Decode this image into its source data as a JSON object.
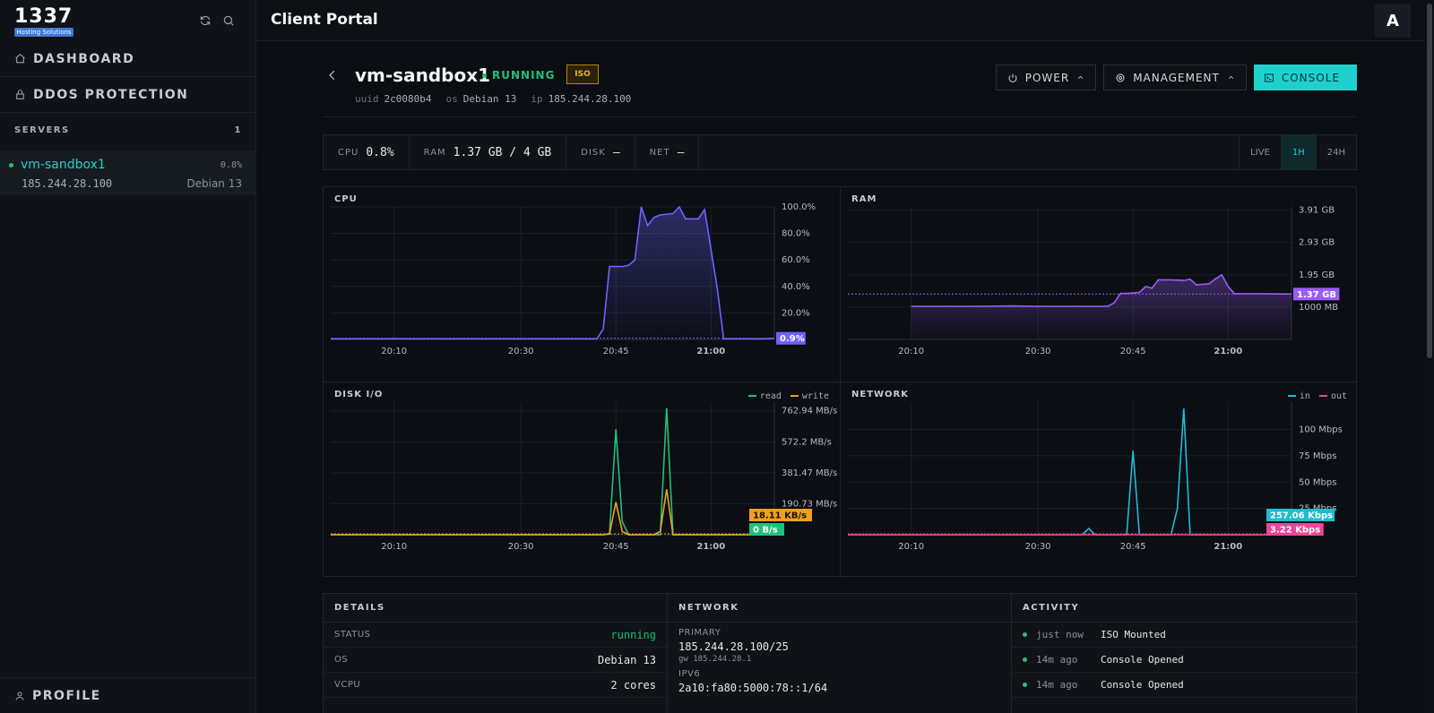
{
  "sidebar": {
    "logo": "1337",
    "logo_sub": "Hosting Solutions",
    "nav": [
      {
        "label": "DASHBOARD",
        "icon": "home-icon"
      },
      {
        "label": "DDOS PROTECTION",
        "icon": "lock-icon"
      }
    ],
    "servers_label": "SERVERS",
    "servers_count": "1",
    "server": {
      "name": "vm-sandbox1",
      "cpu": "0.8%",
      "ip": "185.244.28.100",
      "os": "Debian 13"
    },
    "profile_label": "PROFILE"
  },
  "topbar": {
    "title": "Client Portal",
    "avatar": "A"
  },
  "vm": {
    "name": "vm-sandbox1",
    "status": "RUNNING",
    "badge": "ISO",
    "meta": [
      {
        "k": "uuid",
        "v": "2c0080b4"
      },
      {
        "k": "os",
        "v": "Debian 13"
      },
      {
        "k": "ip",
        "v": "185.244.28.100"
      }
    ],
    "buttons": {
      "power": "POWER",
      "management": "MANAGEMENT",
      "console": "CONSOLE"
    }
  },
  "stats": {
    "cpu_k": "CPU",
    "cpu_v": "0.8%",
    "ram_k": "RAM",
    "ram_v": "1.37 GB / 4 GB",
    "disk_k": "DISK",
    "disk_v": "—",
    "net_k": "NET",
    "net_v": "—",
    "ranges": [
      "LIVE",
      "1H",
      "24H"
    ],
    "active_range": "1H"
  },
  "colors": {
    "cpu": "#6c63ff",
    "ram": "#9b5cf6",
    "read": "#22c07a",
    "write": "#f0a020",
    "in": "#1fbcd1",
    "out": "#e8479a",
    "accent": "#1fd1cc"
  },
  "chart_data": [
    {
      "type": "area",
      "title": "CPU",
      "x": [
        "20:00",
        "20:02",
        "20:04",
        "20:06",
        "20:08",
        "20:10",
        "20:12",
        "20:14",
        "20:16",
        "20:18",
        "20:20",
        "20:22",
        "20:24",
        "20:26",
        "20:28",
        "20:30",
        "20:32",
        "20:34",
        "20:36",
        "20:38",
        "20:40",
        "20:42",
        "20:43",
        "20:44",
        "20:46",
        "20:47",
        "20:48",
        "20:49",
        "20:50",
        "20:51",
        "20:52",
        "20:54",
        "20:55",
        "20:56",
        "20:58",
        "20:59",
        "21:01",
        "21:02",
        "21:03",
        "21:04",
        "21:06",
        "21:08",
        "21:10"
      ],
      "series": [
        {
          "values": [
            0.5,
            0.5,
            0.5,
            0.5,
            0.5,
            0.5,
            0.5,
            0.5,
            0.5,
            0.5,
            0.5,
            0.5,
            0.5,
            0.5,
            0.5,
            0.5,
            0.5,
            0.5,
            0.5,
            0.5,
            0.5,
            0.5,
            8,
            55,
            55,
            56,
            60,
            100,
            86,
            92,
            94,
            95,
            100,
            91,
            91,
            98,
            38,
            0.5,
            0.5,
            0.5,
            0.5,
            0.5,
            0.9
          ]
        }
      ],
      "y_ticks": [
        "100.0%",
        "80.0%",
        "60.0%",
        "40.0%",
        "20.0%"
      ],
      "x_ticks": [
        "20:10",
        "20:30",
        "20:45",
        "21:00"
      ],
      "ylim": [
        0,
        100
      ],
      "current": "0.9%"
    },
    {
      "type": "area",
      "title": "RAM",
      "x": [
        "20:10",
        "20:20",
        "20:26",
        "20:30",
        "20:40",
        "20:41",
        "20:42",
        "20:43",
        "20:44",
        "20:46",
        "20:47",
        "20:48",
        "20:49",
        "20:51",
        "20:53",
        "20:54",
        "20:55",
        "20:57",
        "20:58",
        "20:59",
        "21:00",
        "21:01",
        "21:02",
        "21:03",
        "21:05",
        "21:10"
      ],
      "series": [
        {
          "values": [
            1.0,
            1.0,
            1.01,
            1.0,
            1.0,
            1.0,
            1.1,
            1.39,
            1.39,
            1.42,
            1.6,
            1.55,
            1.8,
            1.8,
            1.78,
            1.82,
            1.65,
            1.68,
            1.83,
            1.95,
            1.6,
            1.38,
            1.38,
            1.38,
            1.38,
            1.37
          ]
        }
      ],
      "y_ticks": [
        "3.91 GB",
        "2.93 GB",
        "1.95 GB",
        "1000 MB"
      ],
      "x_ticks": [
        "20:10",
        "20:30",
        "20:45",
        "21:00"
      ],
      "ylim": [
        0,
        4
      ],
      "current": "1.37 GB"
    },
    {
      "type": "line",
      "title": "DISK I/O",
      "x": [
        "20:00",
        "20:10",
        "20:20",
        "20:30",
        "20:40",
        "20:43",
        "20:44",
        "20:45",
        "20:46",
        "20:47",
        "20:48",
        "20:50",
        "20:51",
        "20:52",
        "20:53",
        "20:54",
        "20:56",
        "20:58",
        "21:00",
        "21:10"
      ],
      "series": [
        {
          "name": "read",
          "values": [
            0,
            0,
            0,
            0,
            0,
            0,
            8,
            650,
            80,
            0,
            0,
            0,
            0,
            0,
            780,
            0,
            0,
            0,
            0,
            0
          ]
        },
        {
          "name": "write",
          "values": [
            0,
            0,
            0,
            0,
            0,
            0,
            5,
            200,
            20,
            0,
            0,
            0,
            0,
            20,
            280,
            0,
            0,
            0,
            0,
            0
          ]
        }
      ],
      "y_ticks": [
        "762.94 MB/s",
        "572.2 MB/s",
        "381.47 MB/s",
        "190.73 MB/s"
      ],
      "x_ticks": [
        "20:10",
        "20:30",
        "20:45",
        "21:00"
      ],
      "current_write": "18.11 KB/s",
      "current_read": "0 B/s"
    },
    {
      "type": "line",
      "title": "NETWORK",
      "x": [
        "20:00",
        "20:10",
        "20:20",
        "20:30",
        "20:37",
        "20:38",
        "20:39",
        "20:40",
        "20:44",
        "20:45",
        "20:46",
        "20:47",
        "20:51",
        "20:52",
        "20:53",
        "20:54",
        "20:56",
        "21:00",
        "21:10"
      ],
      "series": [
        {
          "name": "in",
          "values": [
            0,
            0,
            0,
            0,
            0,
            6,
            0,
            0,
            0,
            80,
            0,
            0,
            0,
            25,
            120,
            0,
            0,
            0,
            0
          ]
        },
        {
          "name": "out",
          "values": [
            0,
            0,
            0,
            0,
            0,
            0,
            0,
            0,
            0,
            0,
            0,
            0,
            0,
            0,
            0,
            0,
            0,
            0,
            0
          ]
        }
      ],
      "y_ticks": [
        "100 Mbps",
        "75 Mbps",
        "50 Mbps",
        "25 Mbps"
      ],
      "x_ticks": [
        "20:10",
        "20:30",
        "20:45",
        "21:00"
      ],
      "current_in": "257.06 Kbps",
      "current_out": "3.22 Kbps"
    }
  ],
  "details": {
    "title": "DETAILS",
    "rows": [
      {
        "k": "STATUS",
        "v": "running"
      },
      {
        "k": "OS",
        "v": "Debian 13"
      },
      {
        "k": "VCPU",
        "v": "2 cores"
      }
    ]
  },
  "network": {
    "title": "NETWORK",
    "primary_k": "PRIMARY",
    "primary_v": "185.244.28.100/25",
    "gw": "gw 185.244.28.1",
    "ipv6_k": "IPV6",
    "ipv6_v": "2a10:fa80:5000:78::1/64"
  },
  "activity": {
    "title": "ACTIVITY",
    "items": [
      {
        "t": "just now",
        "e": "ISO Mounted"
      },
      {
        "t": "14m ago",
        "e": "Console Opened"
      },
      {
        "t": "14m ago",
        "e": "Console Opened"
      }
    ]
  }
}
